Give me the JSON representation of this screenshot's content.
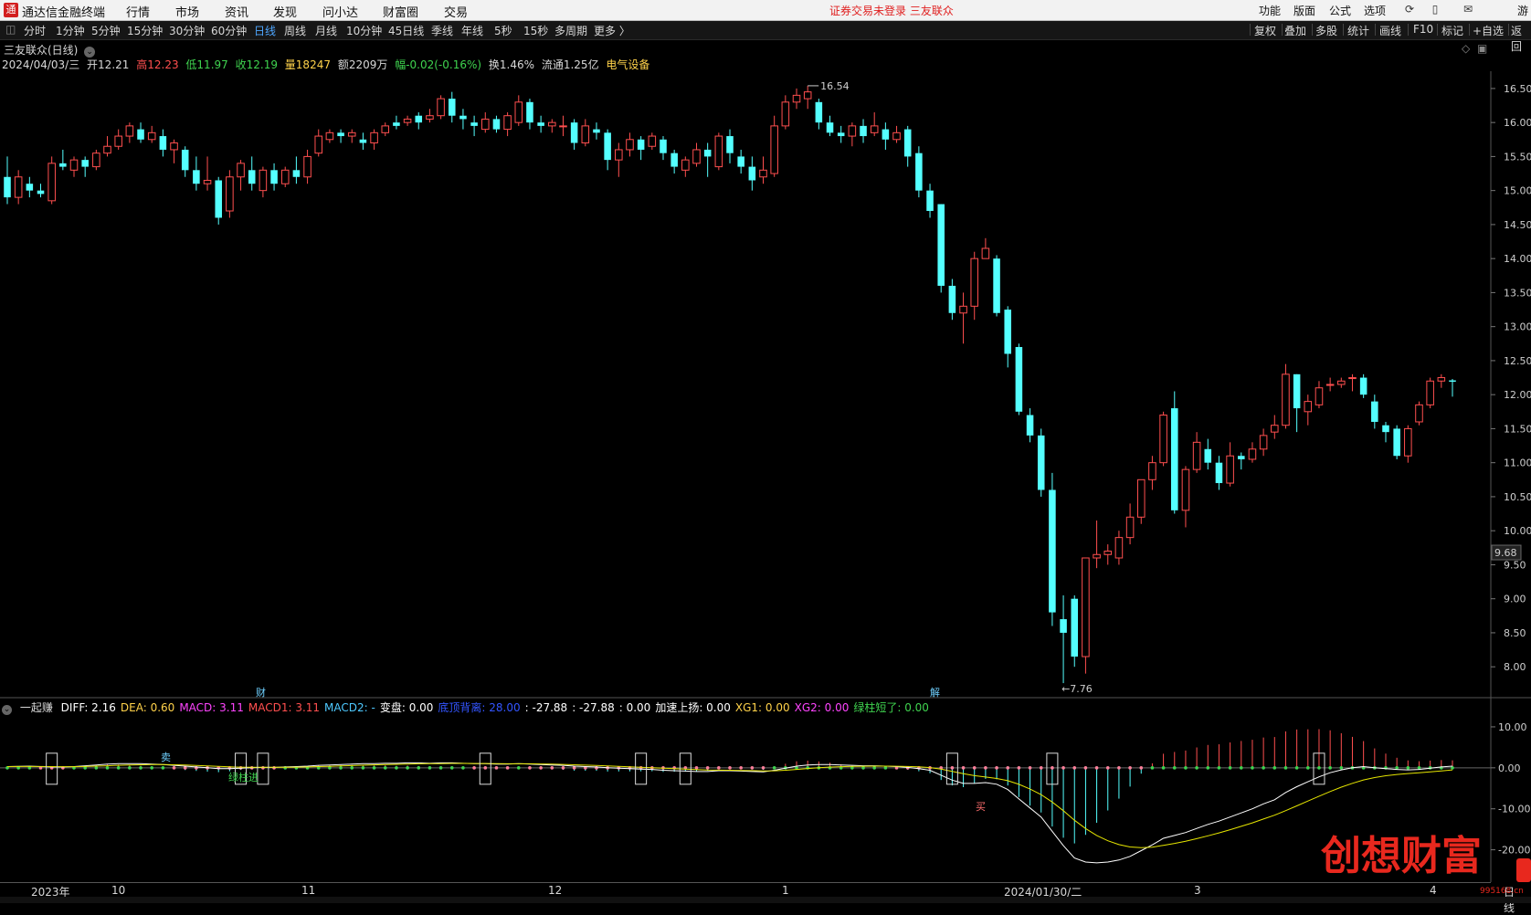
{
  "menubar": {
    "logo": "通",
    "app_title": "通达信金融终端",
    "items": [
      "行情",
      "市场",
      "资讯",
      "发现",
      "问小达",
      "财富圈",
      "交易"
    ],
    "notice": "证券交易未登录   三友联众",
    "right_items": [
      "功能",
      "版面",
      "公式",
      "选项"
    ],
    "right_icons": [
      "refresh-icon",
      "phone-icon",
      "mail-icon"
    ],
    "edge_label": "游"
  },
  "periodbar": {
    "items": [
      "分时",
      "1分钟",
      "5分钟",
      "15分钟",
      "30分钟",
      "60分钟",
      "日线",
      "周线",
      "月线",
      "10分钟",
      "45日线",
      "季线",
      "年线",
      "5秒",
      "15秒",
      "多周期",
      "更多 〉"
    ],
    "active": "日线",
    "tools": [
      "复权",
      "叠加",
      "多股",
      "统计",
      "画线",
      "F10",
      "标记",
      "+自选",
      "返回"
    ]
  },
  "stock": {
    "name": "三友联众(日线)",
    "date": "2024/04/03/三",
    "open": "开12.21",
    "high": "高12.23",
    "low": "低11.97",
    "close": "收12.19",
    "volume": "量18247",
    "amount": "额2209万",
    "change": "幅-0.02(-0.16%)",
    "turnover": "换1.46%",
    "float": "流通1.25亿",
    "sector": "电气设备"
  },
  "price_axis": {
    "ticks": [
      "16.50",
      "16.00",
      "15.50",
      "15.00",
      "14.50",
      "14.00",
      "13.50",
      "13.00",
      "12.50",
      "12.00",
      "11.50",
      "11.00",
      "10.50",
      "10.00",
      "9.50",
      "9.00",
      "8.50",
      "8.00"
    ],
    "current_price": "9.68",
    "high_marker": "16.54",
    "low_marker": "←7.76",
    "event_markers": [
      "财",
      "解"
    ]
  },
  "indicator": {
    "name": "一起赚",
    "values": [
      {
        "text": "DIFF: 2.16",
        "color": "#ffffff"
      },
      {
        "text": "DEA: 0.60",
        "color": "#ffd24a"
      },
      {
        "text": "MACD: 3.11",
        "color": "#ff44ff"
      },
      {
        "text": "MACD1: 3.11",
        "color": "#ff4f4f"
      },
      {
        "text": "MACD2: -",
        "color": "#4ec9ff"
      },
      {
        "text": "变盘: 0.00",
        "color": "#ffffff"
      },
      {
        "text": "底顶背离: 28.00",
        "color": "#3355ff"
      },
      {
        "text": ": -27.88",
        "color": "#ffffff"
      },
      {
        "text": ": -27.88",
        "color": "#ffffff"
      },
      {
        "text": ": 0.00",
        "color": "#ffffff"
      },
      {
        "text": "加速上扬: 0.00",
        "color": "#ffffff"
      },
      {
        "text": "XG1: 0.00",
        "color": "#ffd24a"
      },
      {
        "text": "XG2: 0.00",
        "color": "#ff44ff"
      },
      {
        "text": "绿柱短了: 0.00",
        "color": "#3fd34f"
      }
    ],
    "axis_ticks": [
      "10.00",
      "0.00",
      "-10.00",
      "-20.00"
    ],
    "signal_labels": [
      "卖",
      "买",
      "绿柱进"
    ]
  },
  "date_axis": {
    "labels": [
      {
        "text": "2023年",
        "pos": 0.02
      },
      {
        "text": "10",
        "pos": 0.073
      },
      {
        "text": "11",
        "pos": 0.197
      },
      {
        "text": "12",
        "pos": 0.358
      },
      {
        "text": "1",
        "pos": 0.511
      },
      {
        "text": "2024/01/30/二",
        "pos": 0.656
      },
      {
        "text": "3",
        "pos": 0.78
      },
      {
        "text": "4",
        "pos": 0.934
      }
    ],
    "right_label": "日线"
  },
  "watermark": {
    "text": "创想财富",
    "url": "995168.cn"
  },
  "colors": {
    "up": "#ff4f4f",
    "down": "#54ffff",
    "diff": "#ffffff",
    "dea": "#e6e600",
    "buy_dot": "#3fd34f",
    "sell_dot": "#ff7f9a"
  },
  "chart_data": {
    "type": "candlestick",
    "title": "三友联众(日线)",
    "y_axis": {
      "min": 7.6,
      "max": 16.7,
      "ticks": [
        8.0,
        8.5,
        9.0,
        9.5,
        10.0,
        10.5,
        11.0,
        11.5,
        12.0,
        12.5,
        13.0,
        13.5,
        14.0,
        14.5,
        15.0,
        15.5,
        16.0,
        16.5
      ]
    },
    "candles": [
      [
        15.2,
        14.9,
        15.5,
        14.8
      ],
      [
        14.9,
        15.2,
        15.3,
        14.8
      ],
      [
        15.1,
        15.0,
        15.2,
        14.9
      ],
      [
        15.0,
        14.95,
        15.1,
        14.9
      ],
      [
        14.85,
        15.4,
        15.5,
        14.8
      ],
      [
        15.4,
        15.35,
        15.6,
        15.3
      ],
      [
        15.3,
        15.45,
        15.5,
        15.2
      ],
      [
        15.45,
        15.35,
        15.5,
        15.2
      ],
      [
        15.35,
        15.55,
        15.6,
        15.3
      ],
      [
        15.55,
        15.65,
        15.8,
        15.5
      ],
      [
        15.65,
        15.8,
        15.9,
        15.6
      ],
      [
        15.8,
        15.95,
        16.0,
        15.7
      ],
      [
        15.9,
        15.75,
        16.0,
        15.7
      ],
      [
        15.75,
        15.85,
        15.95,
        15.7
      ],
      [
        15.8,
        15.6,
        15.9,
        15.5
      ],
      [
        15.6,
        15.7,
        15.75,
        15.4
      ],
      [
        15.6,
        15.3,
        15.65,
        15.2
      ],
      [
        15.3,
        15.1,
        15.5,
        15.0
      ],
      [
        15.1,
        15.15,
        15.5,
        15.0
      ],
      [
        15.15,
        14.6,
        15.2,
        14.5
      ],
      [
        14.7,
        15.2,
        15.3,
        14.6
      ],
      [
        15.2,
        15.4,
        15.45,
        15.0
      ],
      [
        15.3,
        15.1,
        15.5,
        15.0
      ],
      [
        15.0,
        15.3,
        15.35,
        14.9
      ],
      [
        15.3,
        15.1,
        15.4,
        15.0
      ],
      [
        15.1,
        15.3,
        15.35,
        15.05
      ],
      [
        15.3,
        15.2,
        15.5,
        15.1
      ],
      [
        15.2,
        15.5,
        15.6,
        15.1
      ],
      [
        15.55,
        15.8,
        15.9,
        15.5
      ],
      [
        15.75,
        15.85,
        15.9,
        15.7
      ],
      [
        15.85,
        15.8,
        15.9,
        15.7
      ],
      [
        15.8,
        15.85,
        15.9,
        15.7
      ],
      [
        15.75,
        15.7,
        15.85,
        15.6
      ],
      [
        15.7,
        15.85,
        15.9,
        15.6
      ],
      [
        15.85,
        15.95,
        16.0,
        15.8
      ],
      [
        16.0,
        15.95,
        16.1,
        15.9
      ],
      [
        16.0,
        16.05,
        16.1,
        15.95
      ],
      [
        16.1,
        16.0,
        16.15,
        15.9
      ],
      [
        16.05,
        16.1,
        16.2,
        16.0
      ],
      [
        16.1,
        16.35,
        16.4,
        16.05
      ],
      [
        16.35,
        16.1,
        16.45,
        16.0
      ],
      [
        16.1,
        16.05,
        16.2,
        15.9
      ],
      [
        16.0,
        15.95,
        16.1,
        15.8
      ],
      [
        15.9,
        16.05,
        16.15,
        15.85
      ],
      [
        16.05,
        15.9,
        16.1,
        15.85
      ],
      [
        15.9,
        16.1,
        16.15,
        15.8
      ],
      [
        16.0,
        16.3,
        16.4,
        15.95
      ],
      [
        16.3,
        16.0,
        16.35,
        15.9
      ],
      [
        16.0,
        15.95,
        16.1,
        15.85
      ],
      [
        15.95,
        16.0,
        16.05,
        15.85
      ],
      [
        15.95,
        15.95,
        16.1,
        15.8
      ],
      [
        16.0,
        15.7,
        16.05,
        15.6
      ],
      [
        15.7,
        15.95,
        16.05,
        15.65
      ],
      [
        15.9,
        15.85,
        16.0,
        15.75
      ],
      [
        15.85,
        15.45,
        15.9,
        15.3
      ],
      [
        15.45,
        15.6,
        15.7,
        15.2
      ],
      [
        15.6,
        15.75,
        15.85,
        15.5
      ],
      [
        15.75,
        15.6,
        15.8,
        15.45
      ],
      [
        15.65,
        15.8,
        15.85,
        15.6
      ],
      [
        15.75,
        15.55,
        15.8,
        15.45
      ],
      [
        15.55,
        15.35,
        15.6,
        15.25
      ],
      [
        15.3,
        15.45,
        15.5,
        15.2
      ],
      [
        15.4,
        15.6,
        15.7,
        15.35
      ],
      [
        15.6,
        15.5,
        15.7,
        15.2
      ],
      [
        15.35,
        15.8,
        15.85,
        15.3
      ],
      [
        15.8,
        15.55,
        15.9,
        15.4
      ],
      [
        15.5,
        15.35,
        15.6,
        15.25
      ],
      [
        15.35,
        15.15,
        15.5,
        15.0
      ],
      [
        15.2,
        15.3,
        15.5,
        15.1
      ],
      [
        15.25,
        15.95,
        16.1,
        15.2
      ],
      [
        15.95,
        16.3,
        16.4,
        15.9
      ],
      [
        16.3,
        16.4,
        16.5,
        16.2
      ],
      [
        16.35,
        16.45,
        16.54,
        16.2
      ],
      [
        16.3,
        16.0,
        16.35,
        15.9
      ],
      [
        16.0,
        15.85,
        16.1,
        15.8
      ],
      [
        15.85,
        15.8,
        15.95,
        15.7
      ],
      [
        15.8,
        15.95,
        16.0,
        15.65
      ],
      [
        15.95,
        15.8,
        16.05,
        15.7
      ],
      [
        15.85,
        15.95,
        16.15,
        15.8
      ],
      [
        15.9,
        15.75,
        16.0,
        15.6
      ],
      [
        15.75,
        15.85,
        15.95,
        15.7
      ],
      [
        15.9,
        15.5,
        15.95,
        15.35
      ],
      [
        15.55,
        15.0,
        15.65,
        14.9
      ],
      [
        15.0,
        14.7,
        15.1,
        14.6
      ],
      [
        14.8,
        13.6,
        14.8,
        13.5
      ],
      [
        13.6,
        13.2,
        13.7,
        13.1
      ],
      [
        13.2,
        13.3,
        13.5,
        12.75
      ],
      [
        13.3,
        14.0,
        14.1,
        13.1
      ],
      [
        14.0,
        14.15,
        14.3,
        14.0
      ],
      [
        14.0,
        13.2,
        14.05,
        13.15
      ],
      [
        13.25,
        12.6,
        13.3,
        12.4
      ],
      [
        12.7,
        11.75,
        12.75,
        11.7
      ],
      [
        11.7,
        11.4,
        11.8,
        11.3
      ],
      [
        11.4,
        10.6,
        11.5,
        10.5
      ],
      [
        10.6,
        8.8,
        10.85,
        8.6
      ],
      [
        8.7,
        8.5,
        9.05,
        7.76
      ],
      [
        9.0,
        8.15,
        9.05,
        8.0
      ],
      [
        8.15,
        9.6,
        9.6,
        7.9
      ],
      [
        9.6,
        9.65,
        10.15,
        9.45
      ],
      [
        9.65,
        9.7,
        9.8,
        9.5
      ],
      [
        9.6,
        9.9,
        10.0,
        9.5
      ],
      [
        9.9,
        10.2,
        10.4,
        9.8
      ],
      [
        10.2,
        10.75,
        10.75,
        10.1
      ],
      [
        10.75,
        11.0,
        11.1,
        10.6
      ],
      [
        11.0,
        11.7,
        11.75,
        10.95
      ],
      [
        11.8,
        10.3,
        12.05,
        10.25
      ],
      [
        10.3,
        10.9,
        10.95,
        10.05
      ],
      [
        10.9,
        11.3,
        11.45,
        10.85
      ],
      [
        11.2,
        11.0,
        11.35,
        10.9
      ],
      [
        11.0,
        10.7,
        11.1,
        10.6
      ],
      [
        10.7,
        11.1,
        11.3,
        10.65
      ],
      [
        11.1,
        11.05,
        11.15,
        10.9
      ],
      [
        11.05,
        11.2,
        11.3,
        11.0
      ],
      [
        11.2,
        11.4,
        11.5,
        11.1
      ],
      [
        11.45,
        11.55,
        11.7,
        11.35
      ],
      [
        11.55,
        12.3,
        12.45,
        11.5
      ],
      [
        12.3,
        11.8,
        12.3,
        11.45
      ],
      [
        11.75,
        11.9,
        12.0,
        11.55
      ],
      [
        11.85,
        12.1,
        12.2,
        11.8
      ],
      [
        12.15,
        12.15,
        12.25,
        12.05
      ],
      [
        12.15,
        12.2,
        12.25,
        12.1
      ],
      [
        12.25,
        12.25,
        12.3,
        12.05
      ],
      [
        12.25,
        12.0,
        12.3,
        11.95
      ],
      [
        11.9,
        11.6,
        12.0,
        11.5
      ],
      [
        11.55,
        11.45,
        11.6,
        11.3
      ],
      [
        11.5,
        11.1,
        11.55,
        11.05
      ],
      [
        11.1,
        11.5,
        11.55,
        11.0
      ],
      [
        11.6,
        11.85,
        11.9,
        11.55
      ],
      [
        11.85,
        12.2,
        12.25,
        11.8
      ],
      [
        12.2,
        12.25,
        12.3,
        12.1
      ],
      [
        12.21,
        12.19,
        12.23,
        11.97
      ]
    ],
    "diff": [
      0.3,
      0.35,
      0.4,
      0.3,
      0.2,
      0.2,
      0.3,
      0.5,
      0.7,
      0.9,
      1.0,
      1.0,
      1.0,
      0.9,
      0.8,
      0.6,
      0.4,
      0.2,
      0.0,
      -0.2,
      -0.2,
      -0.1,
      0.0,
      0.1,
      0.1,
      0.2,
      0.3,
      0.4,
      0.6,
      0.7,
      0.8,
      0.9,
      1.0,
      1.0,
      1.1,
      1.1,
      1.2,
      1.2,
      1.1,
      1.2,
      1.2,
      1.1,
      1.0,
      1.0,
      0.9,
      0.9,
      1.0,
      0.9,
      0.8,
      0.7,
      0.6,
      0.4,
      0.3,
      0.2,
      0.0,
      -0.1,
      -0.2,
      -0.3,
      -0.4,
      -0.6,
      -0.7,
      -0.8,
      -0.9,
      -0.9,
      -0.7,
      -0.7,
      -0.8,
      -0.9,
      -1.0,
      -0.6,
      -0.1,
      0.4,
      0.7,
      0.8,
      0.8,
      0.7,
      0.6,
      0.5,
      0.5,
      0.4,
      0.3,
      0.1,
      -0.2,
      -0.6,
      -1.8,
      -3.0,
      -3.8,
      -3.8,
      -3.6,
      -4.0,
      -5.3,
      -7.6,
      -9.8,
      -12.0,
      -15.5,
      -19.0,
      -22.0,
      -23.0,
      -23.2,
      -23.0,
      -22.5,
      -21.6,
      -20.2,
      -18.8,
      -17.2,
      -16.5,
      -15.8,
      -14.8,
      -13.8,
      -13.0,
      -12.0,
      -11.0,
      -10.0,
      -8.8,
      -7.8,
      -6.0,
      -4.6,
      -3.4,
      -2.2,
      -1.2,
      -0.5,
      0.0,
      0.3,
      0.0,
      -0.2,
      -0.4,
      -0.5,
      -0.4,
      -0.1,
      0.2,
      0.4
    ]
  }
}
